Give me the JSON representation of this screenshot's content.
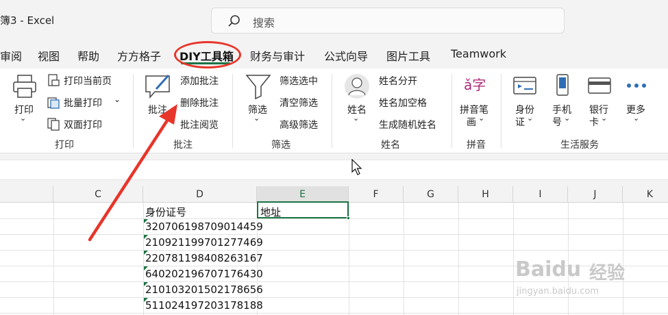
{
  "window": {
    "title": "簿3 - Excel"
  },
  "search": {
    "placeholder": "搜索"
  },
  "tabs": [
    "审阅",
    "视图",
    "帮助",
    "方方格子",
    "DIY工具箱",
    "财务与审计",
    "公式向导",
    "图片工具",
    "Teamwork"
  ],
  "active_tab": "DIY工具箱",
  "ribbon": {
    "print_group": {
      "label": "打印",
      "print_button": "打印",
      "print_current": "打印当前页",
      "batch_print": "批量打印",
      "duplex_print": "双面打印"
    },
    "comment_group": {
      "label": "批注",
      "comment_button": "批注",
      "add_comment": "添加批注",
      "delete_comment": "删除批注",
      "review_comment": "批注阅览"
    },
    "filter_group": {
      "label": "筛选",
      "filter_button": "筛选",
      "filter_selected": "筛选选中",
      "clear_filter": "清空筛选",
      "advanced_filter": "高级筛选"
    },
    "name_group": {
      "label": "姓名",
      "name_button": "姓名",
      "split_name": "姓名分开",
      "name_space": "姓名加空格",
      "random_name": "生成随机姓名"
    },
    "pinyin_group": {
      "label": "拼音",
      "pinyin_button_line1": "拼音笔",
      "pinyin_button_line2": "画",
      "pinyin_icon_text": "ǎ字"
    },
    "life_group": {
      "label": "生活服务",
      "id_card_line1": "身份",
      "id_card_line2": "证",
      "phone_line1": "手机",
      "phone_line2": "号",
      "bank_line1": "银行",
      "bank_line2": "卡",
      "more": "更多"
    }
  },
  "sheet": {
    "columns": [
      "C",
      "D",
      "E",
      "F",
      "G",
      "H",
      "I",
      "J",
      "K"
    ],
    "selected_column": "E",
    "header_row": {
      "d": "身份证号",
      "e": "地址"
    },
    "id_numbers": [
      "320706198709014459",
      "210921199701277469",
      "220781198408263167",
      "640202196707176430",
      "210103201502178656",
      "511024197203178188"
    ]
  },
  "watermark": {
    "brand": "Baidu",
    "cn": "经验",
    "url": "jingyan.baidu.com"
  },
  "colors": {
    "accent": "#1a7343",
    "annotation_red": "#e8352a"
  }
}
